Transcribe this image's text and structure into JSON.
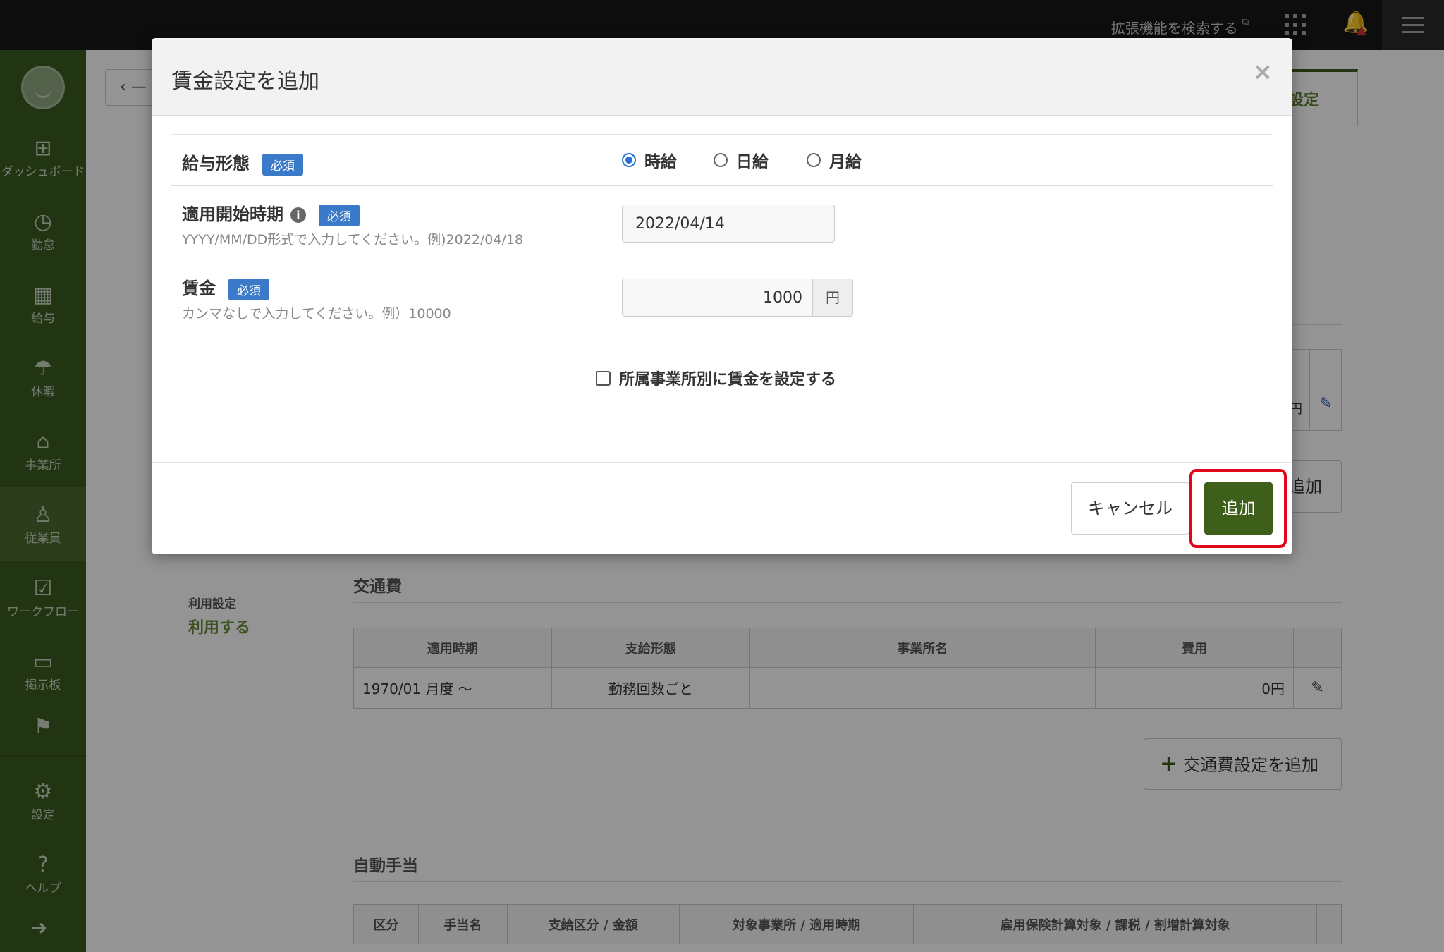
{
  "topbar": {
    "extensions_link": "拡張機能を検索する",
    "extensions_arrow": "⧉"
  },
  "sidebar": {
    "items": [
      {
        "label": "ダッシュボード",
        "icon": "⊞"
      },
      {
        "label": "勤怠",
        "icon": "◷"
      },
      {
        "label": "給与",
        "icon": "▦"
      },
      {
        "label": "休暇",
        "icon": "☂"
      },
      {
        "label": "事業所",
        "icon": "⌂"
      },
      {
        "label": "従業員",
        "icon": "♙"
      },
      {
        "label": "ワークフロー",
        "icon": "☑"
      },
      {
        "label": "掲示板",
        "icon": "▭"
      },
      {
        "label": "",
        "icon": "⚑"
      },
      {
        "label": "設定",
        "icon": "⚙"
      },
      {
        "label": "ヘルプ",
        "icon": "?"
      }
    ],
    "collapse_arrow": "➜"
  },
  "background": {
    "back_label": "‹ —",
    "tab_label": "設定",
    "small_table_yen": "円",
    "add_top_label": "追加",
    "usage": {
      "label": "利用設定",
      "value": "利用する"
    },
    "transport": {
      "title": "交通費",
      "headers": [
        "適用時期",
        "支給形態",
        "事業所名",
        "費用",
        ""
      ],
      "rows": [
        [
          "1970/01 月度 〜",
          "勤務回数ごと",
          "",
          "0円"
        ]
      ]
    },
    "add_transport_label": "交通費設定を追加",
    "allowance": {
      "title": "自動手当",
      "headers": [
        "区分",
        "手当名",
        "支給区分 / 金額",
        "対象事業所 / 適用時期",
        "雇用保険計算対象 / 課税 / 割増計算対象",
        ""
      ]
    }
  },
  "modal": {
    "title": "賃金設定を追加",
    "close": "×",
    "required_badge": "必須",
    "pay_type": {
      "label": "給与形態",
      "options": [
        {
          "label": "時給",
          "checked": true
        },
        {
          "label": "日給",
          "checked": false
        },
        {
          "label": "月給",
          "checked": false
        }
      ]
    },
    "start_date": {
      "label": "適用開始時期",
      "hint": "YYYY/MM/DD形式で入力してください。例)2022/04/18",
      "value": "2022/04/14"
    },
    "wage": {
      "label": "賃金",
      "hint": "カンマなしで入力してください。例）10000",
      "value": "1000",
      "unit": "円"
    },
    "per_office_checkbox": "所属事業所別に賃金を設定する",
    "cancel_label": "キャンセル",
    "add_label": "追加"
  },
  "colors": {
    "sidebar": "#3b5c21",
    "primary_button": "#3e5f19",
    "required_badge": "#3b7ac9",
    "highlight": "#e2061a"
  }
}
